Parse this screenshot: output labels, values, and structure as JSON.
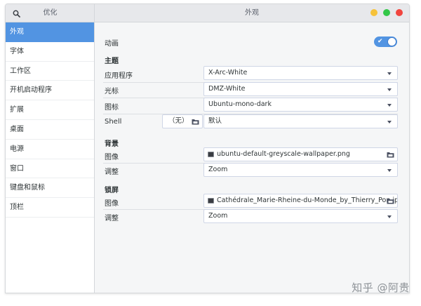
{
  "app": {
    "title": "优化"
  },
  "window": {
    "title": "外观"
  },
  "sidebar": {
    "items": [
      {
        "label": "外观",
        "active": true
      },
      {
        "label": "字体"
      },
      {
        "label": "工作区"
      },
      {
        "label": "开机启动程序"
      },
      {
        "label": "扩展"
      },
      {
        "label": "桌面"
      },
      {
        "label": "电源"
      },
      {
        "label": "窗口"
      },
      {
        "label": "键盘和鼠标"
      },
      {
        "label": "顶栏"
      }
    ]
  },
  "main": {
    "animations": {
      "label": "动画",
      "enabled": true,
      "toggle_glyph": "✔"
    },
    "themes": {
      "heading": "主题",
      "applications": {
        "label": "应用程序",
        "value": "X-Arc-White"
      },
      "cursor": {
        "label": "光标",
        "value": "DMZ-White"
      },
      "icons": {
        "label": "图标",
        "value": "Ubuntu-mono-dark"
      },
      "shell": {
        "label": "Shell",
        "button_label": "（无）",
        "value": "默认"
      }
    },
    "background": {
      "heading": "背景",
      "image": {
        "label": "图像",
        "value": "ubuntu-default-greyscale-wallpaper.png"
      },
      "adjustment": {
        "label": "调整",
        "value": "Zoom"
      }
    },
    "lock_screen": {
      "heading": "锁屏",
      "image": {
        "label": "图像",
        "value": "Cathédrale_Marie-Rheine-du-Monde_by_Thierry_Pon.jpg"
      },
      "adjustment": {
        "label": "调整",
        "value": "Zoom"
      }
    }
  },
  "watermark": {
    "text": "知乎 @阿贵"
  },
  "colors": {
    "accent": "#5294e2",
    "close": "#f1453e",
    "minimize": "#f6c23a",
    "maximize": "#33c748"
  }
}
